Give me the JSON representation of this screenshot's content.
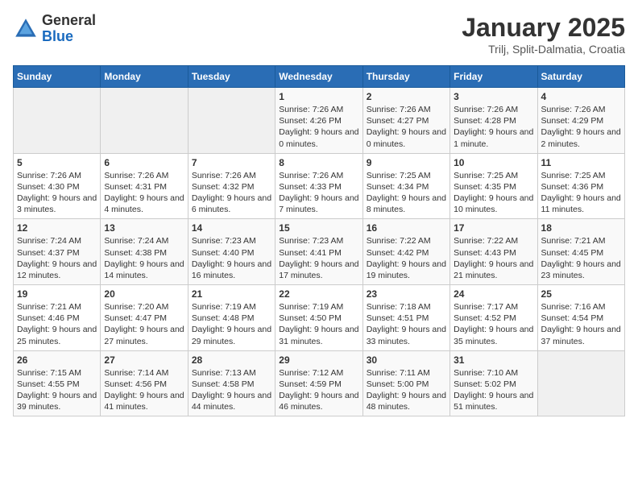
{
  "header": {
    "logo": {
      "general": "General",
      "blue": "Blue"
    },
    "title": "January 2025",
    "subtitle": "Trilj, Split-Dalmatia, Croatia"
  },
  "days_of_week": [
    "Sunday",
    "Monday",
    "Tuesday",
    "Wednesday",
    "Thursday",
    "Friday",
    "Saturday"
  ],
  "weeks": [
    [
      {
        "day": "",
        "sunrise": "",
        "sunset": "",
        "daylight": "",
        "empty": true
      },
      {
        "day": "",
        "sunrise": "",
        "sunset": "",
        "daylight": "",
        "empty": true
      },
      {
        "day": "",
        "sunrise": "",
        "sunset": "",
        "daylight": "",
        "empty": true
      },
      {
        "day": "1",
        "sunrise": "Sunrise: 7:26 AM",
        "sunset": "Sunset: 4:26 PM",
        "daylight": "Daylight: 9 hours and 0 minutes."
      },
      {
        "day": "2",
        "sunrise": "Sunrise: 7:26 AM",
        "sunset": "Sunset: 4:27 PM",
        "daylight": "Daylight: 9 hours and 0 minutes."
      },
      {
        "day": "3",
        "sunrise": "Sunrise: 7:26 AM",
        "sunset": "Sunset: 4:28 PM",
        "daylight": "Daylight: 9 hours and 1 minute."
      },
      {
        "day": "4",
        "sunrise": "Sunrise: 7:26 AM",
        "sunset": "Sunset: 4:29 PM",
        "daylight": "Daylight: 9 hours and 2 minutes."
      }
    ],
    [
      {
        "day": "5",
        "sunrise": "Sunrise: 7:26 AM",
        "sunset": "Sunset: 4:30 PM",
        "daylight": "Daylight: 9 hours and 3 minutes."
      },
      {
        "day": "6",
        "sunrise": "Sunrise: 7:26 AM",
        "sunset": "Sunset: 4:31 PM",
        "daylight": "Daylight: 9 hours and 4 minutes."
      },
      {
        "day": "7",
        "sunrise": "Sunrise: 7:26 AM",
        "sunset": "Sunset: 4:32 PM",
        "daylight": "Daylight: 9 hours and 6 minutes."
      },
      {
        "day": "8",
        "sunrise": "Sunrise: 7:26 AM",
        "sunset": "Sunset: 4:33 PM",
        "daylight": "Daylight: 9 hours and 7 minutes."
      },
      {
        "day": "9",
        "sunrise": "Sunrise: 7:25 AM",
        "sunset": "Sunset: 4:34 PM",
        "daylight": "Daylight: 9 hours and 8 minutes."
      },
      {
        "day": "10",
        "sunrise": "Sunrise: 7:25 AM",
        "sunset": "Sunset: 4:35 PM",
        "daylight": "Daylight: 9 hours and 10 minutes."
      },
      {
        "day": "11",
        "sunrise": "Sunrise: 7:25 AM",
        "sunset": "Sunset: 4:36 PM",
        "daylight": "Daylight: 9 hours and 11 minutes."
      }
    ],
    [
      {
        "day": "12",
        "sunrise": "Sunrise: 7:24 AM",
        "sunset": "Sunset: 4:37 PM",
        "daylight": "Daylight: 9 hours and 12 minutes."
      },
      {
        "day": "13",
        "sunrise": "Sunrise: 7:24 AM",
        "sunset": "Sunset: 4:38 PM",
        "daylight": "Daylight: 9 hours and 14 minutes."
      },
      {
        "day": "14",
        "sunrise": "Sunrise: 7:23 AM",
        "sunset": "Sunset: 4:40 PM",
        "daylight": "Daylight: 9 hours and 16 minutes."
      },
      {
        "day": "15",
        "sunrise": "Sunrise: 7:23 AM",
        "sunset": "Sunset: 4:41 PM",
        "daylight": "Daylight: 9 hours and 17 minutes."
      },
      {
        "day": "16",
        "sunrise": "Sunrise: 7:22 AM",
        "sunset": "Sunset: 4:42 PM",
        "daylight": "Daylight: 9 hours and 19 minutes."
      },
      {
        "day": "17",
        "sunrise": "Sunrise: 7:22 AM",
        "sunset": "Sunset: 4:43 PM",
        "daylight": "Daylight: 9 hours and 21 minutes."
      },
      {
        "day": "18",
        "sunrise": "Sunrise: 7:21 AM",
        "sunset": "Sunset: 4:45 PM",
        "daylight": "Daylight: 9 hours and 23 minutes."
      }
    ],
    [
      {
        "day": "19",
        "sunrise": "Sunrise: 7:21 AM",
        "sunset": "Sunset: 4:46 PM",
        "daylight": "Daylight: 9 hours and 25 minutes."
      },
      {
        "day": "20",
        "sunrise": "Sunrise: 7:20 AM",
        "sunset": "Sunset: 4:47 PM",
        "daylight": "Daylight: 9 hours and 27 minutes."
      },
      {
        "day": "21",
        "sunrise": "Sunrise: 7:19 AM",
        "sunset": "Sunset: 4:48 PM",
        "daylight": "Daylight: 9 hours and 29 minutes."
      },
      {
        "day": "22",
        "sunrise": "Sunrise: 7:19 AM",
        "sunset": "Sunset: 4:50 PM",
        "daylight": "Daylight: 9 hours and 31 minutes."
      },
      {
        "day": "23",
        "sunrise": "Sunrise: 7:18 AM",
        "sunset": "Sunset: 4:51 PM",
        "daylight": "Daylight: 9 hours and 33 minutes."
      },
      {
        "day": "24",
        "sunrise": "Sunrise: 7:17 AM",
        "sunset": "Sunset: 4:52 PM",
        "daylight": "Daylight: 9 hours and 35 minutes."
      },
      {
        "day": "25",
        "sunrise": "Sunrise: 7:16 AM",
        "sunset": "Sunset: 4:54 PM",
        "daylight": "Daylight: 9 hours and 37 minutes."
      }
    ],
    [
      {
        "day": "26",
        "sunrise": "Sunrise: 7:15 AM",
        "sunset": "Sunset: 4:55 PM",
        "daylight": "Daylight: 9 hours and 39 minutes."
      },
      {
        "day": "27",
        "sunrise": "Sunrise: 7:14 AM",
        "sunset": "Sunset: 4:56 PM",
        "daylight": "Daylight: 9 hours and 41 minutes."
      },
      {
        "day": "28",
        "sunrise": "Sunrise: 7:13 AM",
        "sunset": "Sunset: 4:58 PM",
        "daylight": "Daylight: 9 hours and 44 minutes."
      },
      {
        "day": "29",
        "sunrise": "Sunrise: 7:12 AM",
        "sunset": "Sunset: 4:59 PM",
        "daylight": "Daylight: 9 hours and 46 minutes."
      },
      {
        "day": "30",
        "sunrise": "Sunrise: 7:11 AM",
        "sunset": "Sunset: 5:00 PM",
        "daylight": "Daylight: 9 hours and 48 minutes."
      },
      {
        "day": "31",
        "sunrise": "Sunrise: 7:10 AM",
        "sunset": "Sunset: 5:02 PM",
        "daylight": "Daylight: 9 hours and 51 minutes."
      },
      {
        "day": "",
        "sunrise": "",
        "sunset": "",
        "daylight": "",
        "empty": true
      }
    ]
  ]
}
